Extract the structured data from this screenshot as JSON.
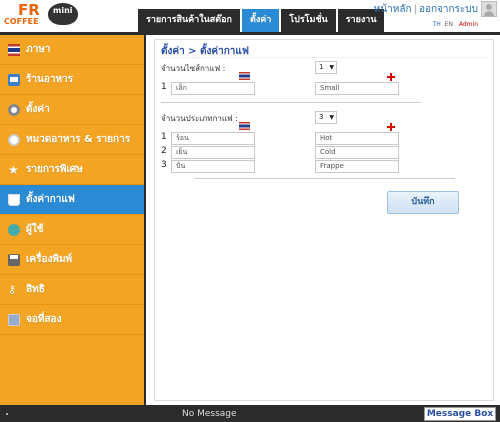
{
  "header": {
    "logo": {
      "fr": "FR",
      "coffee": "COFFEE",
      "mini": "mini"
    },
    "home_link": "หน้าหลัก",
    "logout_link": "ออกจากระบบ",
    "lang_th": "TH",
    "lang_en": "EN",
    "user": "Admin"
  },
  "tabs": [
    {
      "label": "รายการสินค้าในสต๊อก",
      "active": false
    },
    {
      "label": "ตั้งค่า",
      "active": true
    },
    {
      "label": "โปรโมชั่น",
      "active": false
    },
    {
      "label": "รายงาน",
      "active": false
    }
  ],
  "sidebar": {
    "items": [
      {
        "label": "ภาษา",
        "icon": "flag-icon"
      },
      {
        "label": "ร้านอาหาร",
        "icon": "store-icon"
      },
      {
        "label": "ตั้งค่า",
        "icon": "gear-icon"
      },
      {
        "label": "หมวดอาหาร & รายการ",
        "icon": "plate-icon"
      },
      {
        "label": "รายการพิเศษ",
        "icon": "star-icon"
      },
      {
        "label": "ตั้งค่ากาแฟ",
        "icon": "cup-icon",
        "active": true
      },
      {
        "label": "ผู้ใช้",
        "icon": "users-icon"
      },
      {
        "label": "เครื่องพิมพ์",
        "icon": "printer-icon"
      },
      {
        "label": "สิทธิ",
        "icon": "key-icon"
      },
      {
        "label": "จอที่สอง",
        "icon": "monitor-icon"
      }
    ]
  },
  "main": {
    "breadcrumb": "ตั้งค่า > ตั้งค่ากาแฟ",
    "size_section": {
      "label": "จำนวนไซส์กาแฟ :",
      "count": "1",
      "rows": [
        {
          "num": "1",
          "th": "เล็ก",
          "en": "Small"
        }
      ]
    },
    "type_section": {
      "label": "จำนวนประเภทกาแฟ :",
      "count": "3",
      "rows": [
        {
          "num": "1",
          "th": "ร้อน",
          "en": "Hot"
        },
        {
          "num": "2",
          "th": "เย็น",
          "en": "Cold"
        },
        {
          "num": "3",
          "th": "ปั่น",
          "en": "Frappe"
        }
      ]
    },
    "save_label": "บันทึก"
  },
  "footer": {
    "message": "No Message",
    "message_box_label": "Message Box"
  },
  "colors": {
    "sidebar_bg": "#f3a423",
    "active_blue": "#2a8ad4",
    "dark": "#2b2b2b"
  }
}
